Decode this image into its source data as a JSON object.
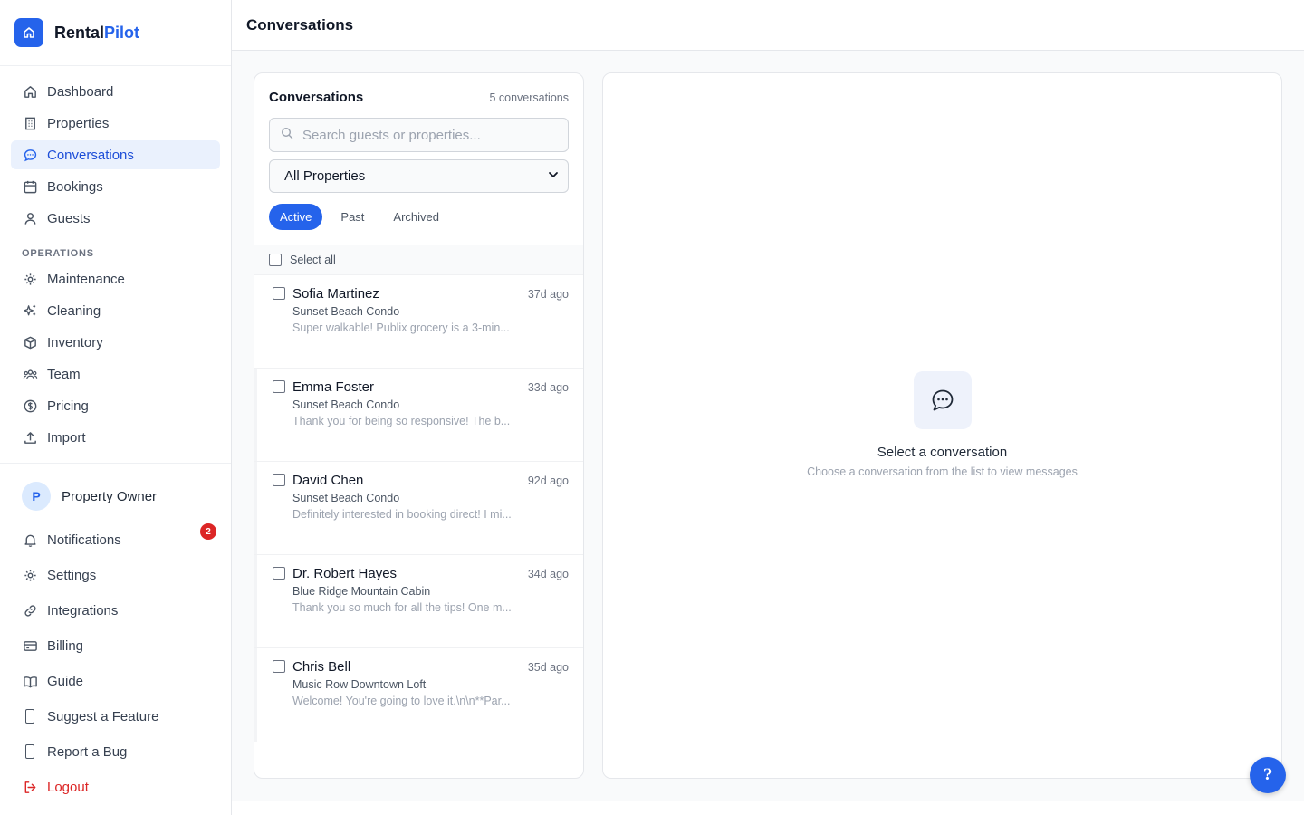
{
  "brand": {
    "name_part1": "Rental",
    "name_part2": "Pilot"
  },
  "nav": {
    "items": [
      {
        "label": "Dashboard",
        "icon": "home-icon"
      },
      {
        "label": "Properties",
        "icon": "building-icon"
      },
      {
        "label": "Conversations",
        "icon": "chat-icon",
        "active": true
      },
      {
        "label": "Bookings",
        "icon": "calendar-icon"
      },
      {
        "label": "Guests",
        "icon": "user-icon"
      }
    ],
    "section_label": "OPERATIONS",
    "ops_items": [
      {
        "label": "Maintenance",
        "icon": "gear-icon"
      },
      {
        "label": "Cleaning",
        "icon": "sparkle-icon"
      },
      {
        "label": "Inventory",
        "icon": "box-icon"
      },
      {
        "label": "Team",
        "icon": "team-icon"
      },
      {
        "label": "Pricing",
        "icon": "dollar-icon"
      },
      {
        "label": "Import",
        "icon": "upload-icon"
      }
    ]
  },
  "user": {
    "avatar_letter": "P",
    "name": "Property Owner"
  },
  "bottom_nav": {
    "notifications": "Notifications",
    "notifications_count": "2",
    "settings": "Settings",
    "integrations": "Integrations",
    "billing": "Billing",
    "guide": "Guide",
    "suggest": "Suggest a Feature",
    "bug": "Report a Bug",
    "logout": "Logout"
  },
  "header": {
    "title": "Conversations"
  },
  "list": {
    "title": "Conversations",
    "count": "5 conversations",
    "search_placeholder": "Search guests or properties...",
    "filter_value": "All Properties",
    "tabs": [
      "Active",
      "Past",
      "Archived"
    ],
    "select_all": "Select all",
    "conversations": [
      {
        "name": "Sofia Martinez",
        "time": "37d ago",
        "property": "Sunset Beach Condo",
        "preview": "Super walkable! Publix grocery is a 3-min..."
      },
      {
        "name": "Emma Foster",
        "time": "33d ago",
        "property": "Sunset Beach Condo",
        "preview": "Thank you for being so responsive! The b..."
      },
      {
        "name": "David Chen",
        "time": "92d ago",
        "property": "Sunset Beach Condo",
        "preview": "Definitely interested in booking direct! I mi..."
      },
      {
        "name": "Dr. Robert Hayes",
        "time": "34d ago",
        "property": "Blue Ridge Mountain Cabin",
        "preview": "Thank you so much for all the tips! One m..."
      },
      {
        "name": "Chris Bell",
        "time": "35d ago",
        "property": "Music Row Downtown Loft",
        "preview": "Welcome! You're going to love it.\\n\\n**Par..."
      }
    ]
  },
  "detail": {
    "empty_title": "Select a conversation",
    "empty_subtitle": "Choose a conversation from the list to view messages"
  },
  "help_button": "?",
  "colors": {
    "accent": "#2563eb",
    "danger": "#dc2626"
  }
}
